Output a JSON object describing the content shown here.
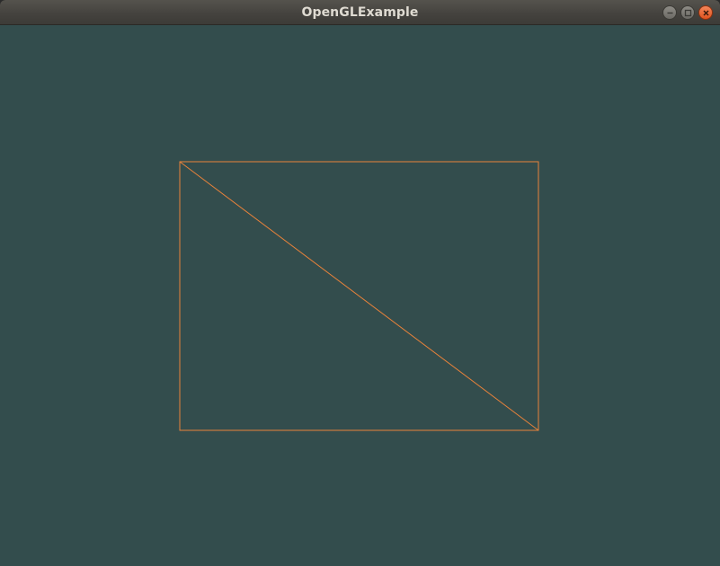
{
  "window": {
    "title": "OpenGLExample"
  },
  "title_buttons": {
    "minimize_icon": "minimize-icon",
    "maximize_icon": "maximize-icon",
    "close_icon": "close-icon"
  },
  "colors": {
    "clear_color": "#334d4d",
    "line_color": "#e8823a",
    "titlebar": "#3c3b37",
    "close_button": "#e95420"
  }
}
